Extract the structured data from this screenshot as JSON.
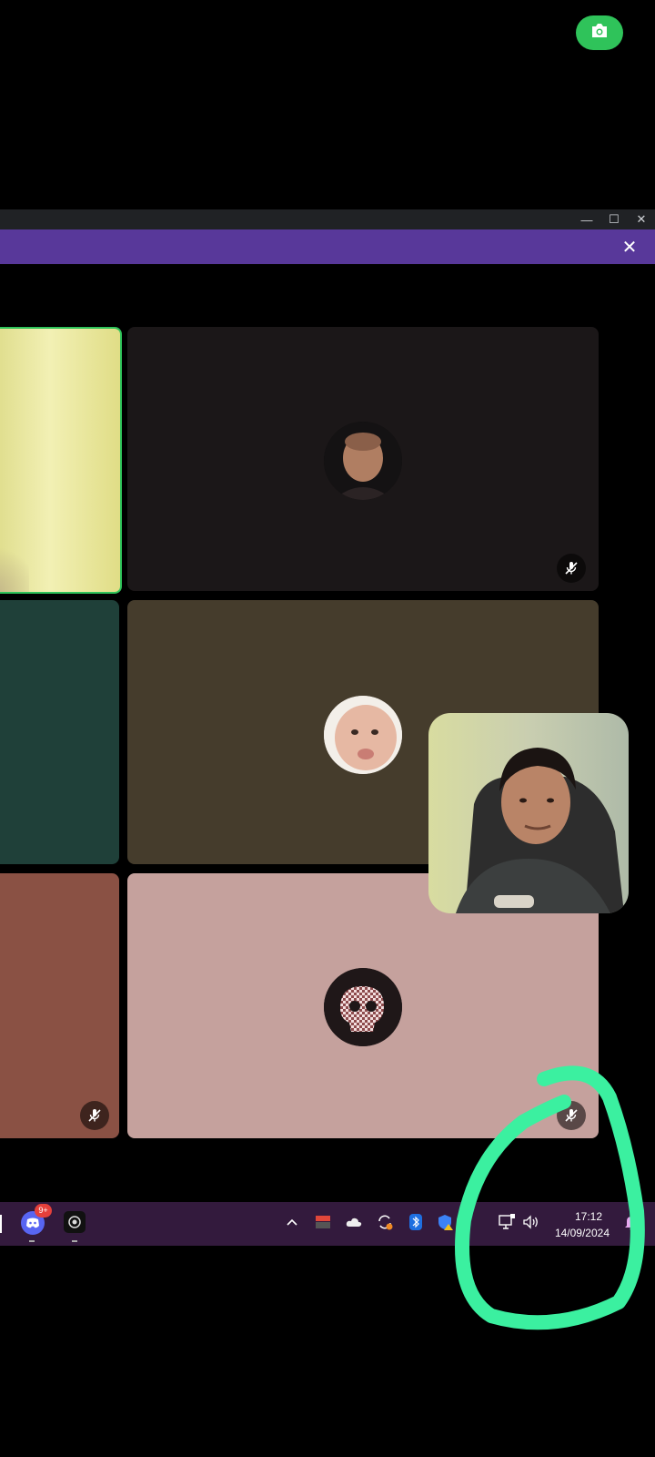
{
  "screenshot_button": {
    "icon": "camera-icon"
  },
  "window": {
    "controls": [
      {
        "name": "minimize",
        "glyph": "—"
      },
      {
        "name": "maximize",
        "glyph": "☐"
      },
      {
        "name": "close",
        "glyph": "✕"
      }
    ]
  },
  "banner": {
    "close_glyph": "✕",
    "color": "#58389a"
  },
  "tiles": [
    {
      "name": "camera-feed-left-top",
      "color": "#e8e39b"
    },
    {
      "name": "participant-bald-man",
      "color": "#1b1718",
      "muted": true
    },
    {
      "name": "participant-left-middle",
      "color": "#1f4039"
    },
    {
      "name": "participant-baby",
      "color": "#453c2c",
      "muted": false
    },
    {
      "name": "participant-left-bottom",
      "color": "#8a5144",
      "muted": true
    },
    {
      "name": "participant-skull",
      "color": "#c5a19d",
      "muted": true
    }
  ],
  "taskbar": {
    "discord_badge": "9+",
    "clock": {
      "time": "17:12",
      "date": "14/09/2024"
    },
    "tray_icons": [
      "chevron-up-icon",
      "app-tray-icon",
      "onedrive-cloud-icon",
      "sync-icon",
      "bluetooth-icon",
      "security-shield-icon",
      "network-icon",
      "volume-icon",
      "notification-bell-icon"
    ]
  },
  "annotation": {
    "color": "#3bf0a0"
  }
}
